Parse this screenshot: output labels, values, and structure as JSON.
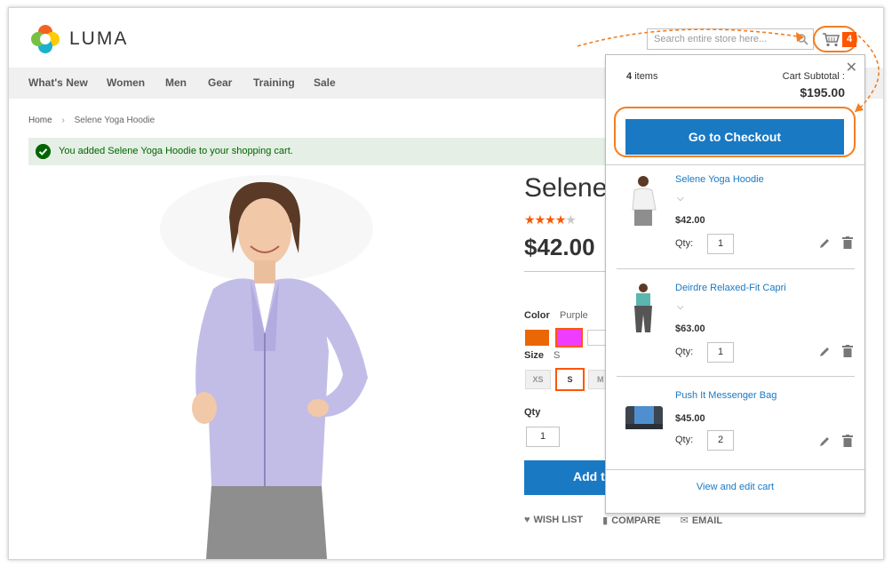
{
  "brand": {
    "name": "LUMA"
  },
  "search": {
    "placeholder": "Search entire store here..."
  },
  "cart": {
    "count": "4"
  },
  "nav": {
    "items": [
      "What's New",
      "Women",
      "Men",
      "Gear",
      "Training",
      "Sale"
    ]
  },
  "breadcrumb": {
    "home": "Home",
    "current": "Selene Yoga Hoodie"
  },
  "message": {
    "text": "You added Selene Yoga Hoodie to your shopping cart."
  },
  "product": {
    "title": "Selene",
    "rating_stars": 4,
    "price": "$42.00",
    "color_label": "Color",
    "color_value": "Purple",
    "size_label": "Size",
    "size_value": "S",
    "sizes": [
      "XS",
      "S",
      "M"
    ],
    "qty_label": "Qty",
    "qty_value": "1",
    "add_button": "Add to Cart",
    "wishlist": "WISH LIST",
    "compare": "COMPARE",
    "email": "EMAIL"
  },
  "minicart": {
    "items_count": "4",
    "items_label": "items",
    "subtotal_label": "Cart Subtotal :",
    "subtotal_value": "$195.00",
    "checkout_button": "Go to Checkout",
    "qty_label": "Qty:",
    "view_edit": "View and edit cart",
    "items": [
      {
        "name": "Selene Yoga Hoodie",
        "price": "$42.00",
        "qty": "1"
      },
      {
        "name": "Deirdre Relaxed-Fit Capri",
        "price": "$63.00",
        "qty": "1"
      },
      {
        "name": "Push It Messenger Bag",
        "price": "$45.00",
        "qty": "2"
      }
    ]
  },
  "colors": {
    "accent_blue": "#1979c3",
    "highlight_orange": "#f37e22",
    "badge_orange": "#ff5501"
  }
}
